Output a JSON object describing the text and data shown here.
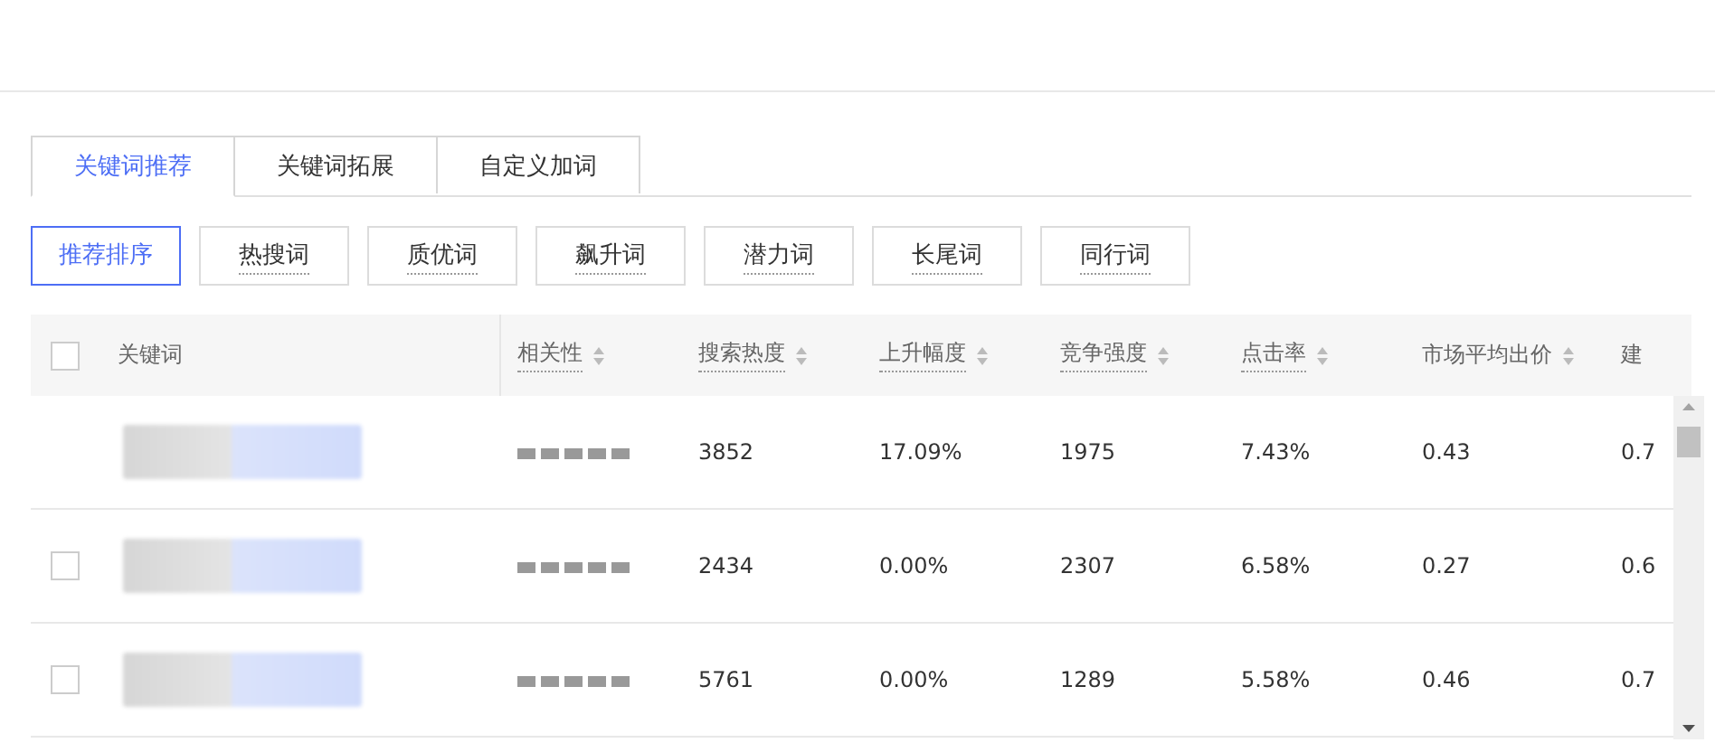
{
  "tabs": [
    {
      "label": "关键词推荐",
      "selected": true
    },
    {
      "label": "关键词拓展",
      "selected": false
    },
    {
      "label": "自定义加词",
      "selected": false
    }
  ],
  "filters": [
    {
      "label": "推荐排序",
      "selected": true,
      "hint": false
    },
    {
      "label": "热搜词",
      "selected": false,
      "hint": true
    },
    {
      "label": "质优词",
      "selected": false,
      "hint": true
    },
    {
      "label": "飙升词",
      "selected": false,
      "hint": true
    },
    {
      "label": "潜力词",
      "selected": false,
      "hint": true
    },
    {
      "label": "长尾词",
      "selected": false,
      "hint": true
    },
    {
      "label": "同行词",
      "selected": false,
      "hint": true
    }
  ],
  "table": {
    "header_checked": false,
    "columns": [
      {
        "label": "关键词",
        "kind": "keyword",
        "sortable": false,
        "hint": false
      },
      {
        "label": "相关性",
        "kind": "relevance",
        "sortable": true,
        "hint": true
      },
      {
        "label": "搜索热度",
        "kind": "text",
        "sortable": true,
        "hint": true
      },
      {
        "label": "上升幅度",
        "kind": "text",
        "sortable": true,
        "hint": true
      },
      {
        "label": "竞争强度",
        "kind": "text",
        "sortable": true,
        "hint": true
      },
      {
        "label": "点击率",
        "kind": "text",
        "sortable": true,
        "hint": true
      },
      {
        "label": "市场平均出价",
        "kind": "text",
        "sortable": true,
        "hint": false
      },
      {
        "label": "建",
        "kind": "text",
        "sortable": false,
        "hint": false
      }
    ],
    "rows": [
      {
        "cells": [
          "",
          "",
          "3852",
          "17.09%",
          "1975",
          "7.43%",
          "0.43",
          "0.7"
        ]
      },
      {
        "checked": false,
        "cells": [
          "",
          "",
          "2434",
          "0.00%",
          "2307",
          "6.58%",
          "0.27",
          "0.6"
        ]
      },
      {
        "checked": false,
        "cells": [
          "",
          "",
          "5761",
          "0.00%",
          "1289",
          "5.58%",
          "0.46",
          "0.7"
        ]
      }
    ]
  }
}
